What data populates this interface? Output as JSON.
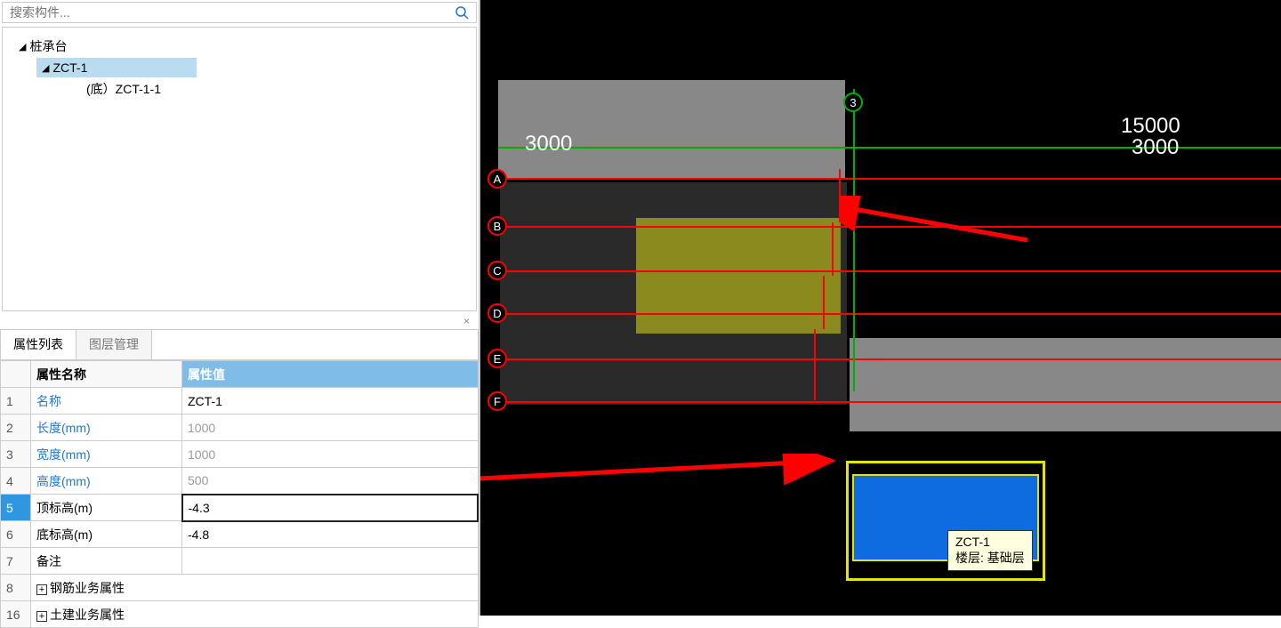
{
  "search": {
    "placeholder": "搜索构件..."
  },
  "tree": {
    "root": "桩承台",
    "child1": "ZCT-1",
    "child2": "(底）ZCT-1-1"
  },
  "tabs": {
    "t1": "属性列表",
    "t2": "图层管理"
  },
  "propHeaders": {
    "name": "属性名称",
    "value": "属性值"
  },
  "props": [
    {
      "num": "1",
      "name": "名称",
      "value": "ZCT-1",
      "black": false,
      "grey": false
    },
    {
      "num": "2",
      "name": "长度(mm)",
      "value": "1000",
      "black": false,
      "grey": true
    },
    {
      "num": "3",
      "name": "宽度(mm)",
      "value": "1000",
      "black": false,
      "grey": true
    },
    {
      "num": "4",
      "name": "高度(mm)",
      "value": "500",
      "black": false,
      "grey": true
    },
    {
      "num": "5",
      "name": "顶标高(m)",
      "value": "-4.3",
      "black": true,
      "grey": false,
      "selected": true
    },
    {
      "num": "6",
      "name": "底标高(m)",
      "value": "-4.8",
      "black": true,
      "grey": false
    },
    {
      "num": "7",
      "name": "备注",
      "value": "",
      "black": true,
      "grey": false
    },
    {
      "num": "8",
      "name": "钢筋业务属性",
      "value": "",
      "black": true,
      "grey": false,
      "expand": true
    },
    {
      "num": "16",
      "name": "土建业务属性",
      "value": "",
      "black": true,
      "grey": false,
      "expand": true
    }
  ],
  "viewport": {
    "axisNum": "3",
    "dims": {
      "d1": "3000",
      "d2": "15000",
      "d3": "3000"
    },
    "axisLetters": [
      "A",
      "B",
      "C",
      "D",
      "E",
      "F"
    ],
    "tooltip": {
      "line1": "ZCT-1",
      "line2": "楼层: 基础层"
    }
  },
  "closeBtn": "×"
}
